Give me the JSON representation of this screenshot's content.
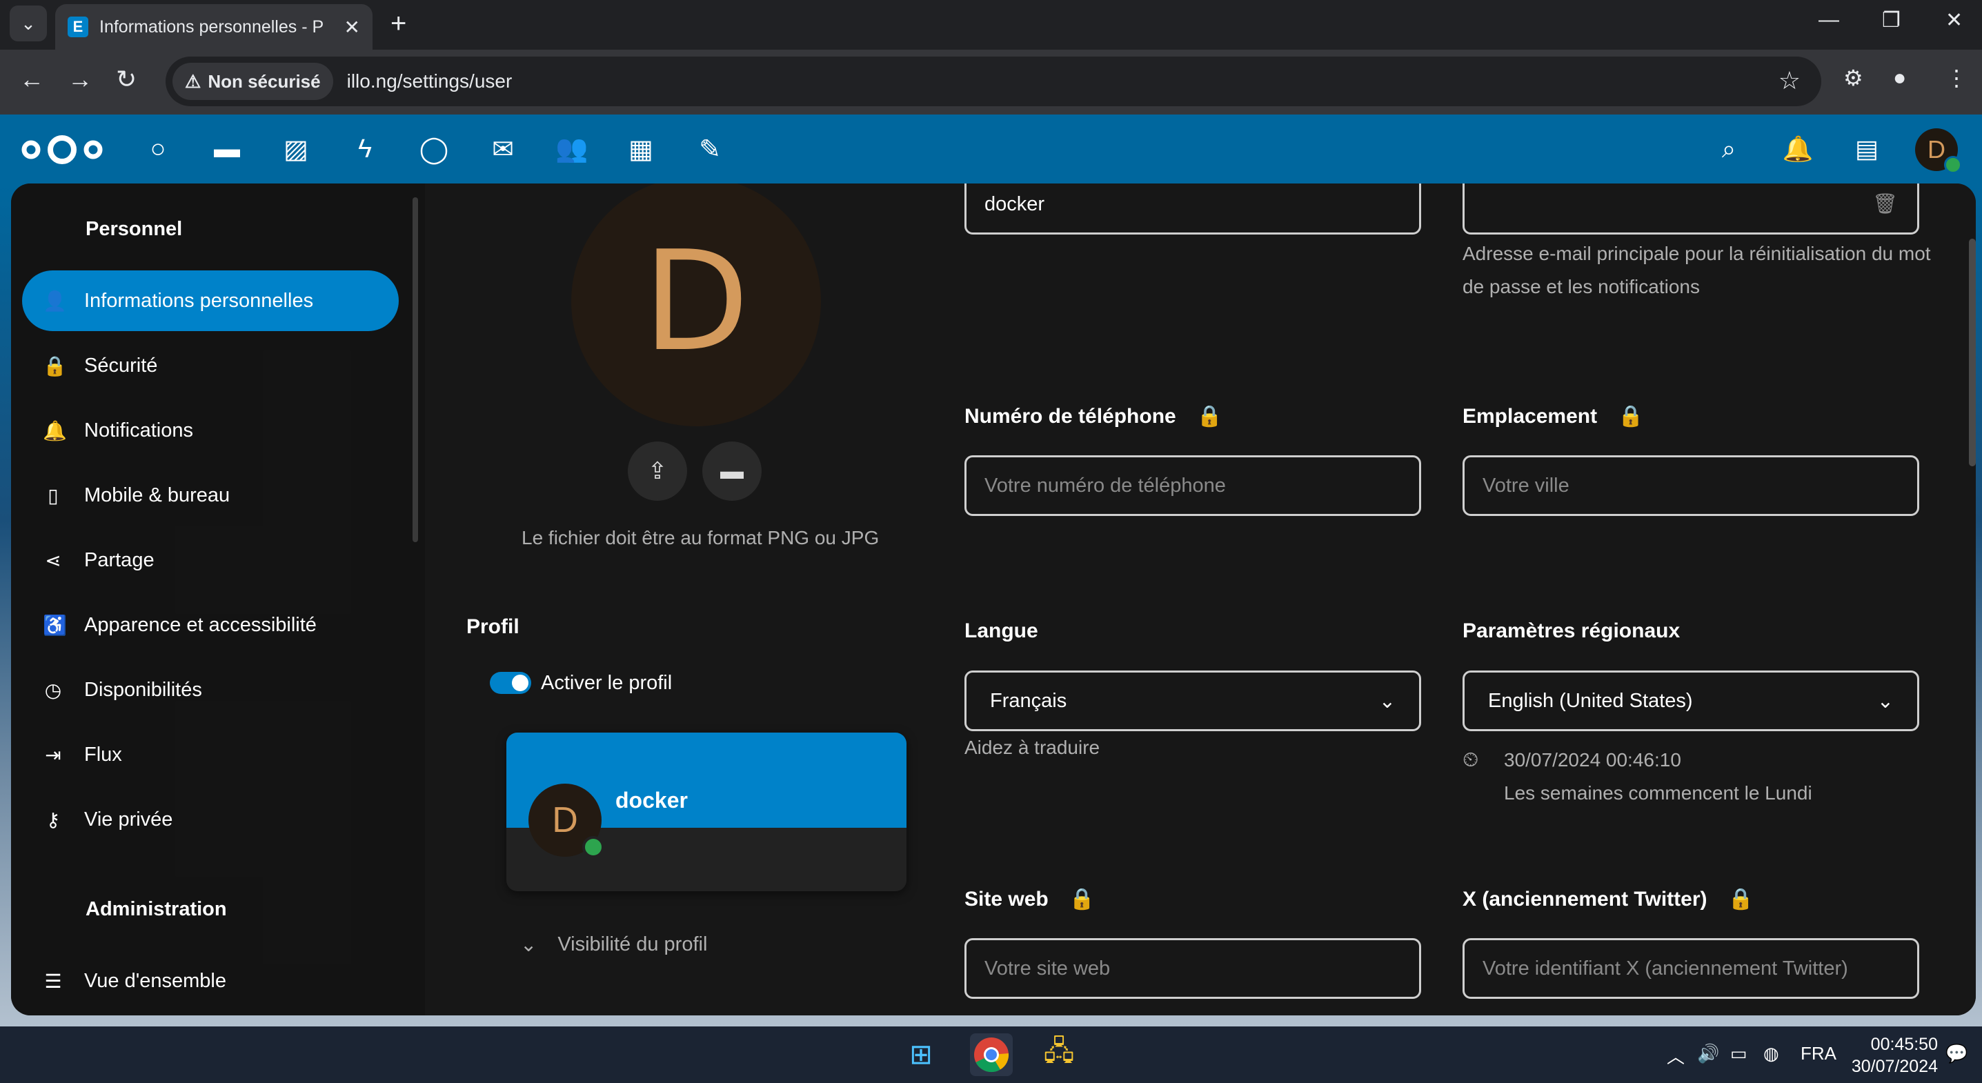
{
  "browser": {
    "tab_title": "Informations personnelles - P",
    "insecure_label": "Non sécurisé",
    "url": "illo.ng/settings/user"
  },
  "header": {
    "apps": [
      "dashboard-icon",
      "files-icon",
      "photos-icon",
      "activity-icon",
      "talk-icon",
      "mail-icon",
      "contacts-icon",
      "calendar-icon",
      "notes-icon"
    ],
    "avatar_letter": "D"
  },
  "sidebar": {
    "section_personal": "Personnel",
    "items": [
      {
        "label": "Informations personnelles",
        "icon": "👤"
      },
      {
        "label": "Sécurité",
        "icon": "🔒"
      },
      {
        "label": "Notifications",
        "icon": "🔔"
      },
      {
        "label": "Mobile & bureau",
        "icon": "▯"
      },
      {
        "label": "Partage",
        "icon": "⋖"
      },
      {
        "label": "Apparence et accessibilité",
        "icon": "♿"
      },
      {
        "label": "Disponibilités",
        "icon": "◷"
      },
      {
        "label": "Flux",
        "icon": "⇥"
      },
      {
        "label": "Vie privée",
        "icon": "⚷"
      }
    ],
    "section_admin": "Administration",
    "admin_items": [
      {
        "label": "Vue d'ensemble",
        "icon": "☰"
      }
    ]
  },
  "avatar": {
    "letter": "D",
    "hint": "Le fichier doit être au format PNG ou JPG"
  },
  "profile": {
    "title": "Profil",
    "toggle_label": "Activer le profil",
    "card_name": "docker",
    "card_letter": "D",
    "visibility_label": "Visibilité du profil"
  },
  "fields": {
    "display_name_value": "docker",
    "email_help": "Adresse e-mail principale pour la réinitialisation du mot de passe et les notifications",
    "phone_label": "Numéro de téléphone",
    "phone_placeholder": "Votre numéro de téléphone",
    "location_label": "Emplacement",
    "location_placeholder": "Votre ville",
    "language_label": "Langue",
    "language_value": "Français",
    "language_help": "Aidez à traduire",
    "locale_label": "Paramètres régionaux",
    "locale_value": "English (United States)",
    "locale_time": "30/07/2024 00:46:10",
    "locale_week": "Les semaines commencent le Lundi",
    "website_label": "Site web",
    "website_placeholder": "Votre site web",
    "twitter_label": "X (anciennement Twitter)",
    "twitter_placeholder": "Votre identifiant X (anciennement Twitter)"
  },
  "taskbar": {
    "lang": "FRA",
    "time": "00:45:50",
    "date": "30/07/2024"
  }
}
